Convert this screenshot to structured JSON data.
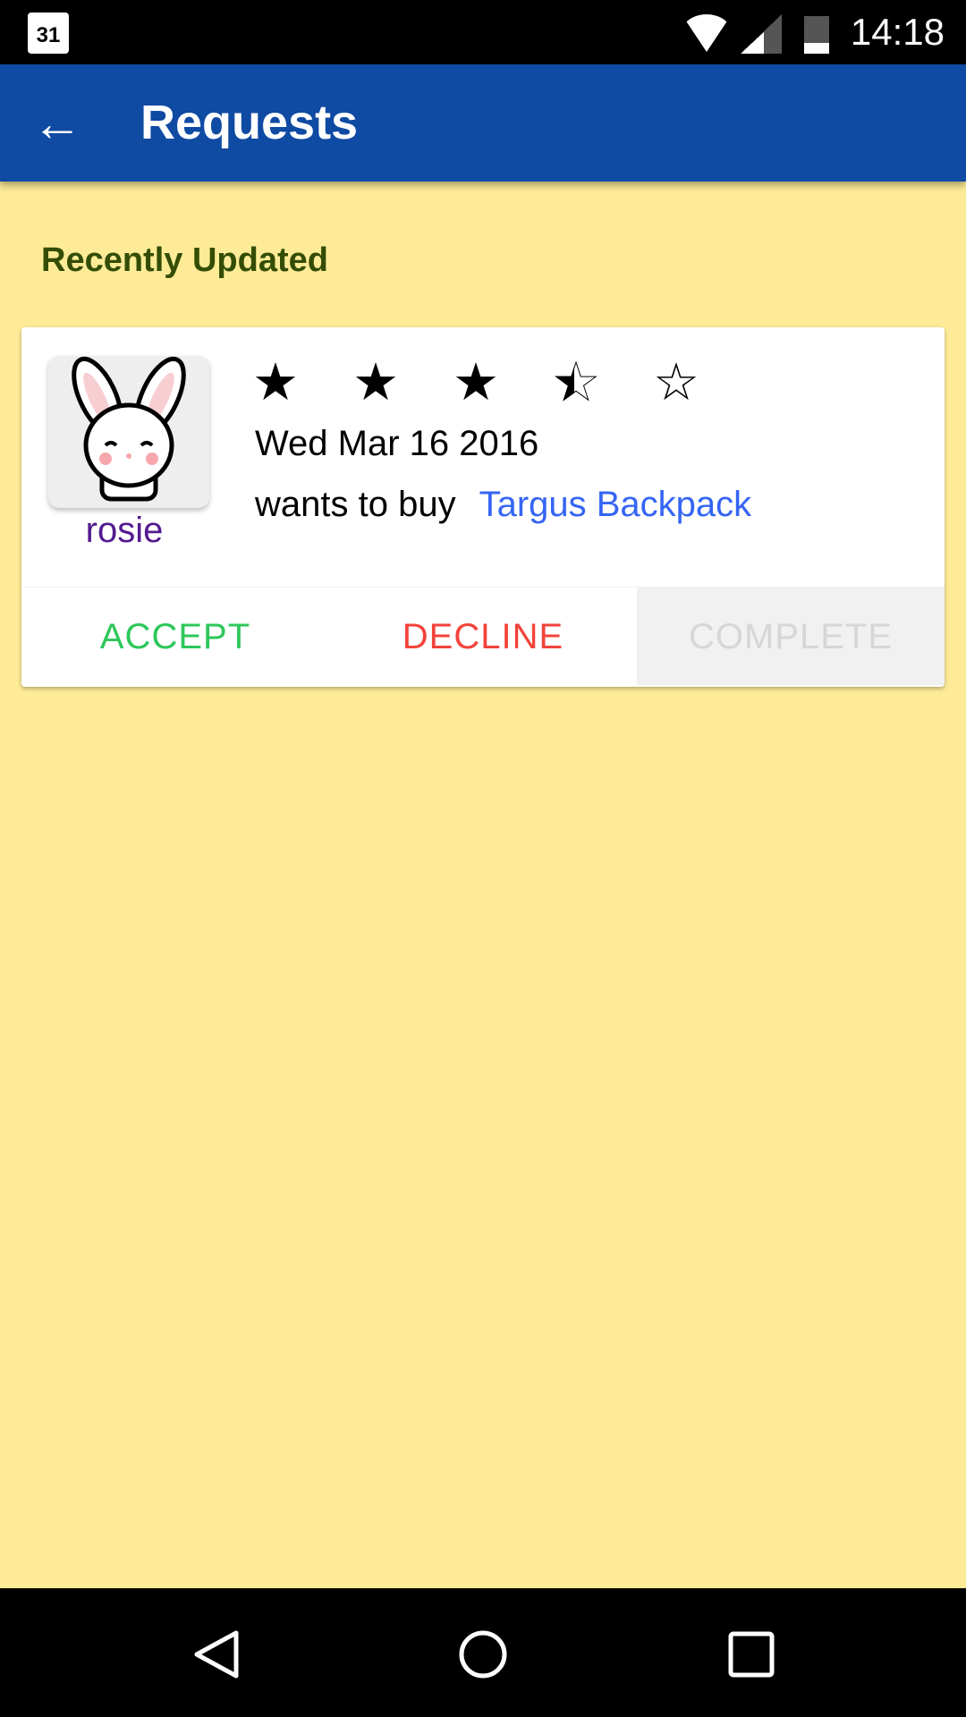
{
  "status_bar": {
    "calendar_day": "31",
    "time": "14:18"
  },
  "app_bar": {
    "title": "Requests"
  },
  "section_title": "Recently Updated",
  "request": {
    "user": "rosie",
    "rating": 3.5,
    "date": "Wed Mar 16 2016",
    "action_text": "wants to buy",
    "item": "Targus Backpack",
    "buttons": {
      "accept": "ACCEPT",
      "decline": "DECLINE",
      "complete": "COMPLETE"
    }
  },
  "colors": {
    "app_bar": "#0f4aa3",
    "background": "#feeb98",
    "accept": "#2ec75a",
    "decline": "#f2433a",
    "link": "#3565f5",
    "username": "#531a8f"
  }
}
